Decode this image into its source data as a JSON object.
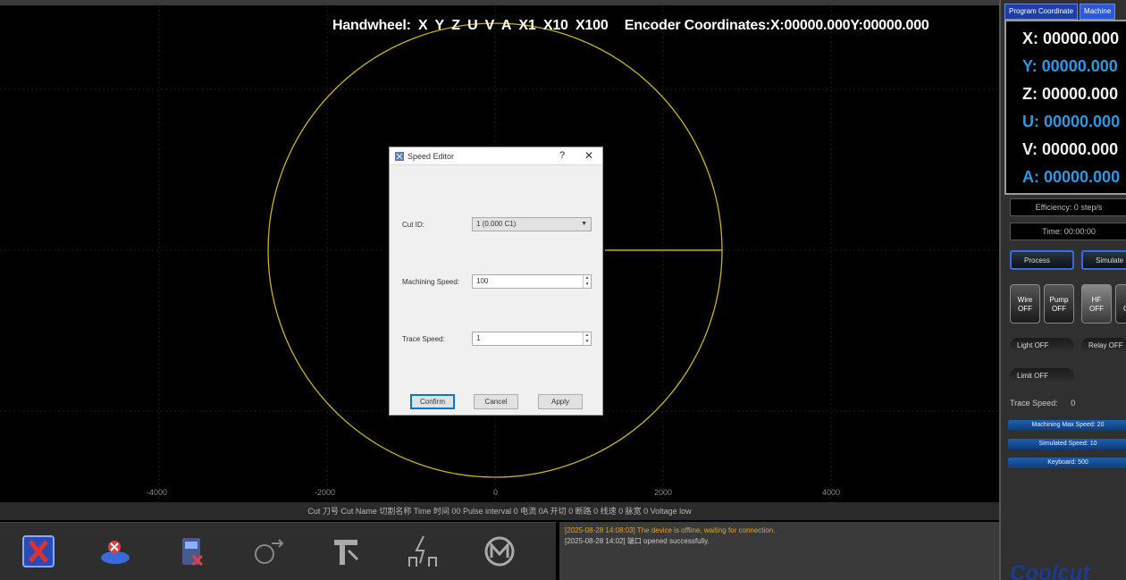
{
  "hud": {
    "handwheel_label": "Handwheel:",
    "axes": [
      "X",
      "Y",
      "Z",
      "U",
      "V",
      "A"
    ],
    "multipliers": [
      "X1",
      "X10",
      "X100"
    ],
    "encoder_label": "Encoder Coordinates:",
    "encoder_x": "X:00000.000",
    "encoder_y": "Y:00000.000"
  },
  "canvas": {
    "ticks": [
      "-4000",
      "-2000",
      "0",
      "2000",
      "4000"
    ],
    "circle_color": "#d4c21a"
  },
  "status_strip": "Cut 刀号 Cut Name 切割名称 Time 时间 00  Pulse interval 0 电流 0A 开切 0 断路 0 线速 0  脉宽 0 Voltage low",
  "toolbar": {
    "tools": [
      "stop-cut-icon",
      "reset-icon",
      "no-power-icon",
      "jog-icon",
      "wire-icon",
      "high-voltage-icon",
      "motor-icon"
    ]
  },
  "log": {
    "warning": "[2025-08-28 14:08:03] The device is offline, waiting for connection.",
    "ok": "[2025-08-28 14:02] 端口 opened successfully."
  },
  "right_panel": {
    "tab_program": "Program Coordinate",
    "tab_machine": "Machine",
    "coords": [
      {
        "label": "X: 00000.000",
        "color": "white"
      },
      {
        "label": "Y: 00000.000",
        "color": "blue"
      },
      {
        "label": "Z: 00000.000",
        "color": "white"
      },
      {
        "label": "U: 00000.000",
        "color": "blue"
      },
      {
        "label": "V: 00000.000",
        "color": "white"
      },
      {
        "label": "A: 00000.000",
        "color": "blue"
      }
    ],
    "efficiency": "Efficiency: 0 step/s",
    "time": "Time: 00:00:00",
    "btn_run_left": "Process",
    "btn_run_right": "Simulate",
    "square_buttons": [
      {
        "top": "Wire",
        "bottom": "OFF"
      },
      {
        "top": "Pump",
        "bottom": "OFF"
      },
      {
        "top": "HF",
        "bottom": "OFF"
      },
      {
        "top": "M",
        "bottom": "OFF"
      }
    ],
    "pill_1": "Light OFF",
    "pill_2": "Relay OFF",
    "pill_3": "Limit OFF",
    "trav_speed_label": "Trace Speed:",
    "trav_speed_value": "0",
    "bar_1": "Machining Max Speed: 20",
    "bar_2": "Simulated Speed: 10",
    "bar_3": "Keyboard: 500",
    "brand": "Coolcut"
  },
  "dialog": {
    "title": "Speed Editor",
    "help": "?",
    "close": "✕",
    "cut_label": "Cut ID:",
    "cut_value": "1 (0.000 C1)",
    "machining_label": "Machining Speed:",
    "machining_value": "100",
    "trace_label": "Trace Speed:",
    "trace_value": "1",
    "confirm": "Confirm",
    "cancel": "Cancel",
    "apply": "Apply"
  }
}
